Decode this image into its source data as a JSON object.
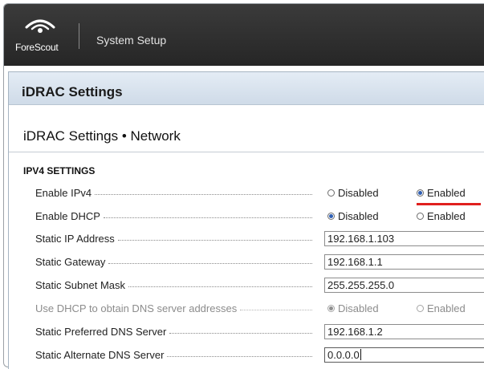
{
  "header": {
    "logo_text": "ForeScout",
    "app_title": "System Setup"
  },
  "page": {
    "title": "iDRAC Settings",
    "breadcrumb": "iDRAC Settings • Network",
    "section": "IPV4 SETTINGS"
  },
  "settings": [
    {
      "label": "Enable IPv4",
      "type": "radio",
      "options": [
        "Disabled",
        "Enabled"
      ],
      "selected": "Enabled"
    },
    {
      "label": "Enable DHCP",
      "type": "radio",
      "options": [
        "Disabled",
        "Enabled"
      ],
      "selected": "Disabled"
    },
    {
      "label": "Static IP Address",
      "type": "text",
      "value": "192.168.1.103"
    },
    {
      "label": "Static Gateway",
      "type": "text",
      "value": "192.168.1.1"
    },
    {
      "label": "Static Subnet Mask",
      "type": "text",
      "value": "255.255.255.0"
    },
    {
      "label": "Use DHCP to obtain DNS server addresses",
      "type": "radio",
      "options": [
        "Disabled",
        "Enabled"
      ],
      "selected": "Disabled",
      "disabled": true
    },
    {
      "label": "Static Preferred DNS Server",
      "type": "text",
      "value": "192.168.1.2"
    },
    {
      "label": "Static Alternate DNS Server",
      "type": "text",
      "value": "0.0.0.0",
      "focused": true
    }
  ],
  "colors": {
    "header_bg": "#2e2e2e",
    "radio_selected": "#2f5fb3",
    "highlight_underline": "#e0201e"
  },
  "icons": {
    "logo": "forescout-logo-icon"
  }
}
